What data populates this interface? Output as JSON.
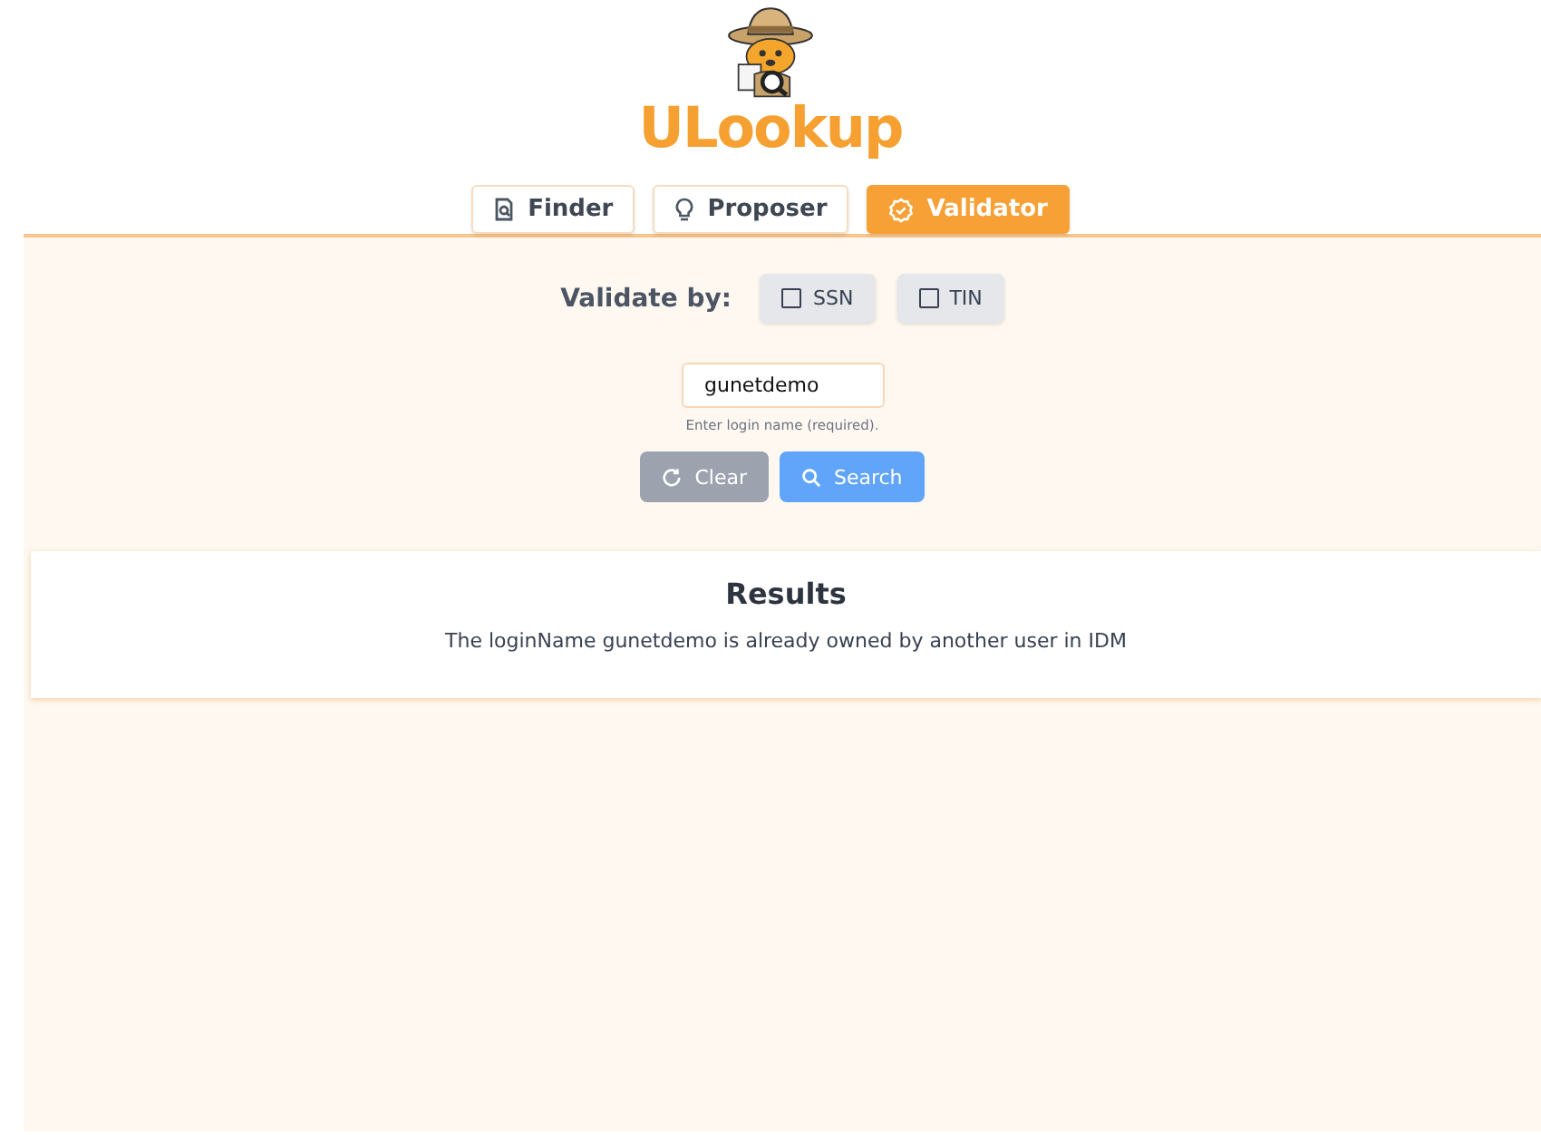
{
  "logo": {
    "text": "ULookup"
  },
  "tabs": [
    {
      "label": "Finder",
      "selected": false
    },
    {
      "label": "Proposer",
      "selected": false
    },
    {
      "label": "Validator",
      "selected": true
    }
  ],
  "validate_by": {
    "label": "Validate by:",
    "options": [
      {
        "label": "SSN",
        "checked": false
      },
      {
        "label": "TIN",
        "checked": false
      }
    ]
  },
  "login_field": {
    "value": "gunetdemo",
    "hint": "Enter login name (required)."
  },
  "buttons": [
    {
      "label": "Clear",
      "kind": "clear"
    },
    {
      "label": "Search",
      "kind": "search"
    }
  ],
  "results": {
    "title": "Results",
    "message": "The loginName gunetdemo is already owned by another user in IDM"
  }
}
